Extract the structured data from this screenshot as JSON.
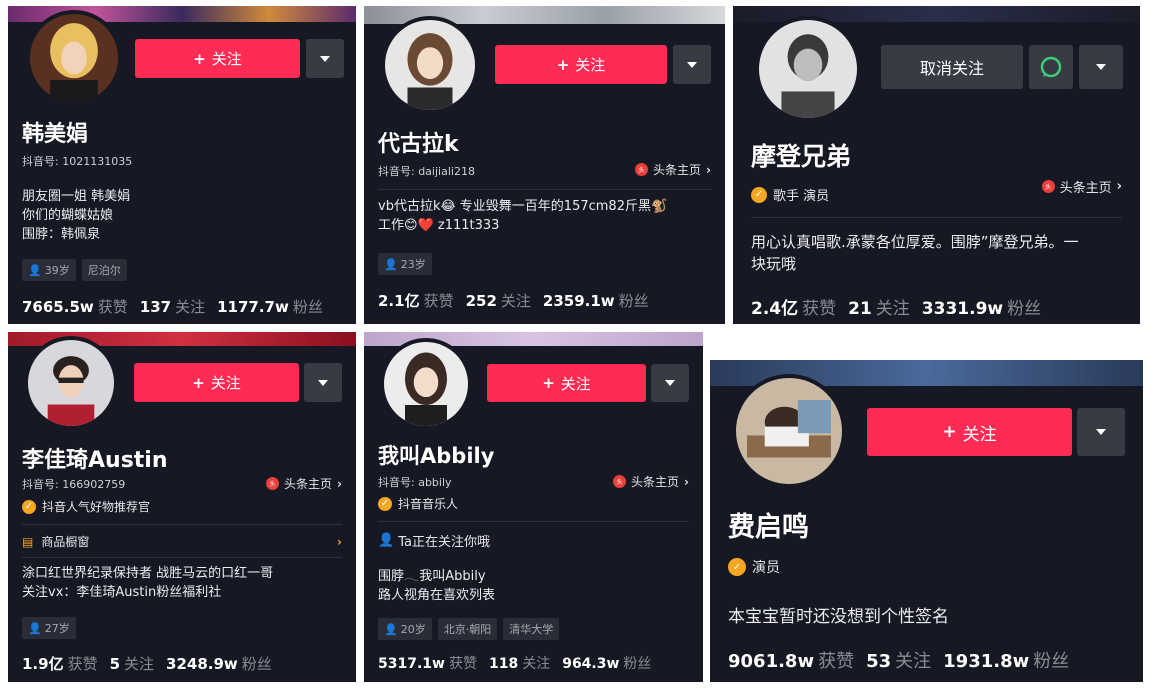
{
  "colors": {
    "accent": "#fe2c55",
    "card_bg": "#161823",
    "verify": "#f5a623",
    "secondary_btn": "#393b44"
  },
  "cards": [
    {
      "name": "韩美娟",
      "douyin_id": "抖音号: 1021131035",
      "follow_label": "关注",
      "bio": [
        "朋友圈一姐 韩美娟",
        "你们的蝴蝶姑娘",
        "围脖：韩佩泉"
      ],
      "tags": [
        "39岁",
        "尼泊尔"
      ],
      "stats": [
        {
          "value": "7665.5w",
          "label": "获赞"
        },
        {
          "value": "137",
          "label": "关注"
        },
        {
          "value": "1177.7w",
          "label": "粉丝"
        }
      ]
    },
    {
      "name": "代古拉k",
      "douyin_id": "抖音号: daijiali218",
      "toutiao_label": "头条主页",
      "follow_label": "关注",
      "bio": [
        "vb代古拉k😂 专业毁舞一百年的157cm82斤黑🐒",
        "工作😊❤️ z111t333"
      ],
      "tags": [
        "23岁"
      ],
      "stats": [
        {
          "value": "2.1亿",
          "label": "获赞"
        },
        {
          "value": "252",
          "label": "关注"
        },
        {
          "value": "2359.1w",
          "label": "粉丝"
        }
      ]
    },
    {
      "name": "摩登兄弟",
      "unfollow_label": "取消关注",
      "verify_label": "歌手 演员",
      "toutiao_label": "头条主页",
      "bio": [
        "用心认真唱歌.承蒙各位厚爱。围脖”摩登兄弟。一",
        "块玩哦"
      ],
      "stats": [
        {
          "value": "2.4亿",
          "label": "获赞"
        },
        {
          "value": "21",
          "label": "关注"
        },
        {
          "value": "3331.9w",
          "label": "粉丝"
        }
      ]
    },
    {
      "name": "李佳琦Austin",
      "douyin_id": "抖音号: 166902759",
      "toutiao_label": "头条主页",
      "verify_label": "抖音人气好物推荐官",
      "shop_label": "商品橱窗",
      "follow_label": "关注",
      "bio": [
        "涂口红世界纪录保持者 战胜马云的口红一哥",
        "关注vx：李佳琦Austin粉丝福利社"
      ],
      "tags": [
        "27岁"
      ],
      "stats": [
        {
          "value": "1.9亿",
          "label": "获赞"
        },
        {
          "value": "5",
          "label": "关注"
        },
        {
          "value": "3248.9w",
          "label": "粉丝"
        }
      ]
    },
    {
      "name": "我叫Abbily",
      "douyin_id": "抖音号: abbily",
      "toutiao_label": "头条主页",
      "verify_label": "抖音音乐人",
      "follow_label": "关注",
      "following_notice": "Ta正在关注你哦",
      "bio": [
        "围脖𓂃我叫Abbily",
        "路人视角在喜欢列表"
      ],
      "tags": [
        "20岁",
        "北京·朝阳",
        "清华大学"
      ],
      "stats": [
        {
          "value": "5317.1w",
          "label": "获赞"
        },
        {
          "value": "118",
          "label": "关注"
        },
        {
          "value": "964.3w",
          "label": "粉丝"
        }
      ]
    },
    {
      "name": "费启鸣",
      "verify_label": "演员",
      "follow_label": "关注",
      "bio": [
        "本宝宝暂时还没想到个性签名"
      ],
      "stats": [
        {
          "value": "9061.8w",
          "label": "获赞"
        },
        {
          "value": "53",
          "label": "关注"
        },
        {
          "value": "1931.8w",
          "label": "粉丝"
        }
      ]
    }
  ]
}
